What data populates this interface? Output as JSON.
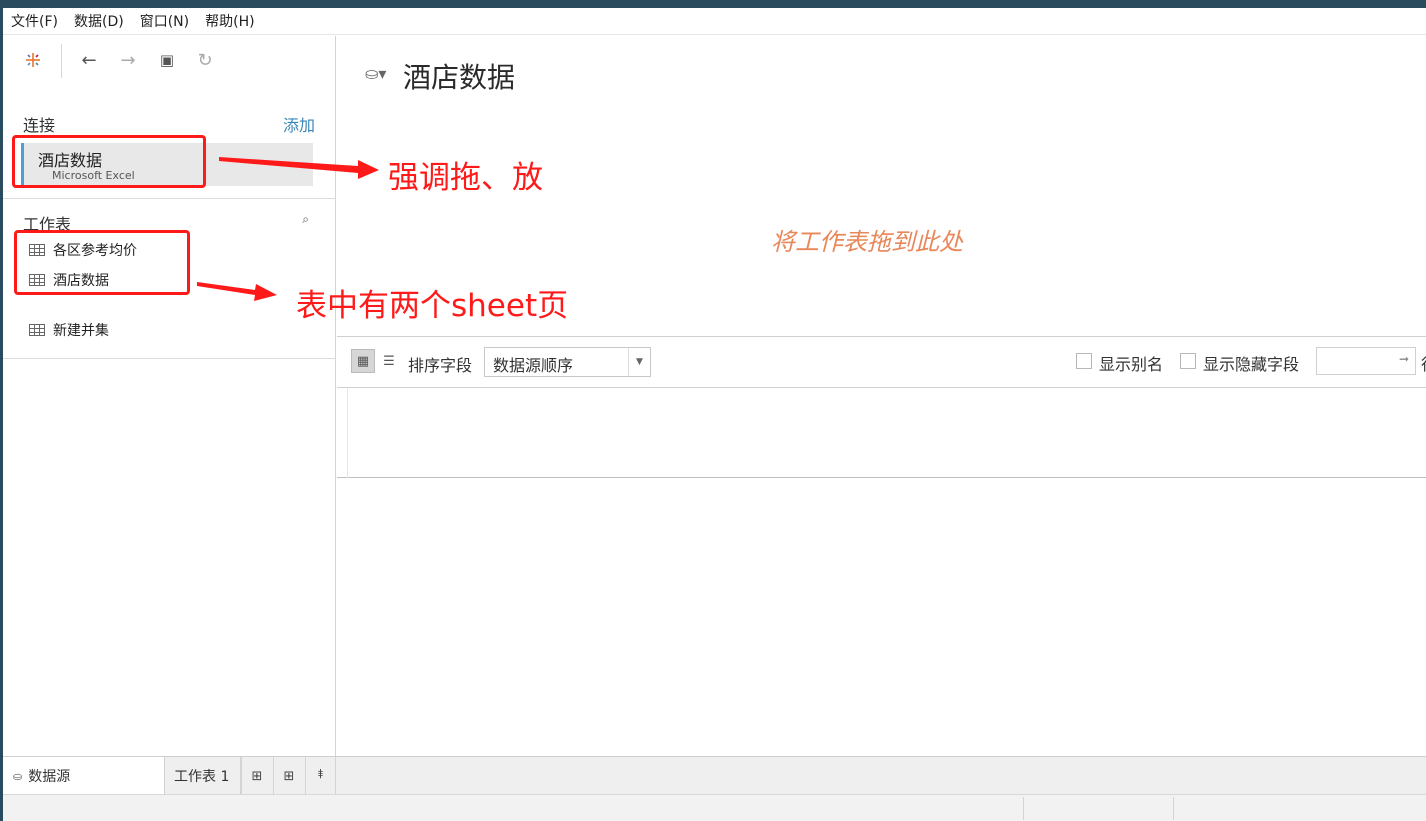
{
  "menu": [
    "文件(F)",
    "数据(D)",
    "窗口(N)",
    "帮助(H)"
  ],
  "toolbar": {
    "logo_icon": "tableau-logo-icon",
    "back_icon": "←",
    "forward_icon": "→",
    "save_icon": "▣",
    "refresh_icon": "↻"
  },
  "connections": {
    "title": "连接",
    "add_label": "添加",
    "items": [
      {
        "name": "酒店数据",
        "type": "Microsoft Excel"
      }
    ]
  },
  "worksheets": {
    "title": "工作表",
    "items": [
      "各区参考均价",
      "酒店数据"
    ],
    "new_union": "新建并集"
  },
  "annotations": {
    "drag_drop": "强调拖、放",
    "two_sheets": "表中有两个sheet页"
  },
  "main": {
    "datasource_title": "酒店数据",
    "drop_hint": "将工作表拖到此处",
    "sort_label": "排序字段",
    "sort_value": "数据源顺序",
    "show_alias": "显示别名",
    "show_hidden": "显示隐藏字段",
    "rows_label": "行"
  },
  "tabs": {
    "datasource": "数据源",
    "sheet1": "工作表 1"
  },
  "colors": {
    "accent": "#3a85b4",
    "annotation": "#ff1a1a",
    "drop_hint": "#e8875a"
  }
}
